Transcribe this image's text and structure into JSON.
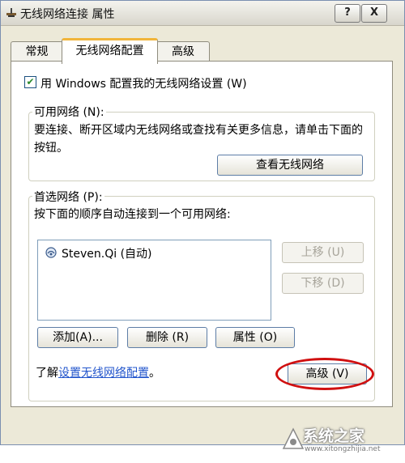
{
  "window": {
    "title": "无线网络连接 属性",
    "help_symbol": "?",
    "close_symbol": "X"
  },
  "tabs": [
    {
      "label": "常规"
    },
    {
      "label": "无线网络配置",
      "selected": true
    },
    {
      "label": "高级"
    }
  ],
  "use_windows": {
    "checked": true,
    "label": "用 Windows 配置我的无线网络设置 (W)"
  },
  "available": {
    "legend": "可用网络 (N):",
    "description": "要连接、断开区域内无线网络或查找有关更多信息，请单击下面的按钮。",
    "view_button": "查看无线网络"
  },
  "preferred": {
    "legend": "首选网络 (P):",
    "description": "按下面的顺序自动连接到一个可用网络:",
    "networks": [
      {
        "label": "Steven.Qi (自动)"
      }
    ],
    "move_up_button": "上移 (U)",
    "move_down_button": "下移 (D)",
    "add_button": "添加(A)...",
    "remove_button": "删除 (R)",
    "properties_button": "属性 (O)"
  },
  "learn": {
    "prefix": "了解",
    "link": "设置无线网络配置",
    "suffix": "。"
  },
  "advanced_button": "高级 (V)",
  "watermark": {
    "site": "系统之家",
    "url": "www.xitongzhijia.net"
  },
  "colors": {
    "dialog_bg": "#ece9d8",
    "panel_bg": "#ffffff",
    "tab_highlight": "#f1b53a",
    "link": "#2255cc",
    "annotation": "#d01010",
    "disabled_text": "#a7a49a"
  }
}
